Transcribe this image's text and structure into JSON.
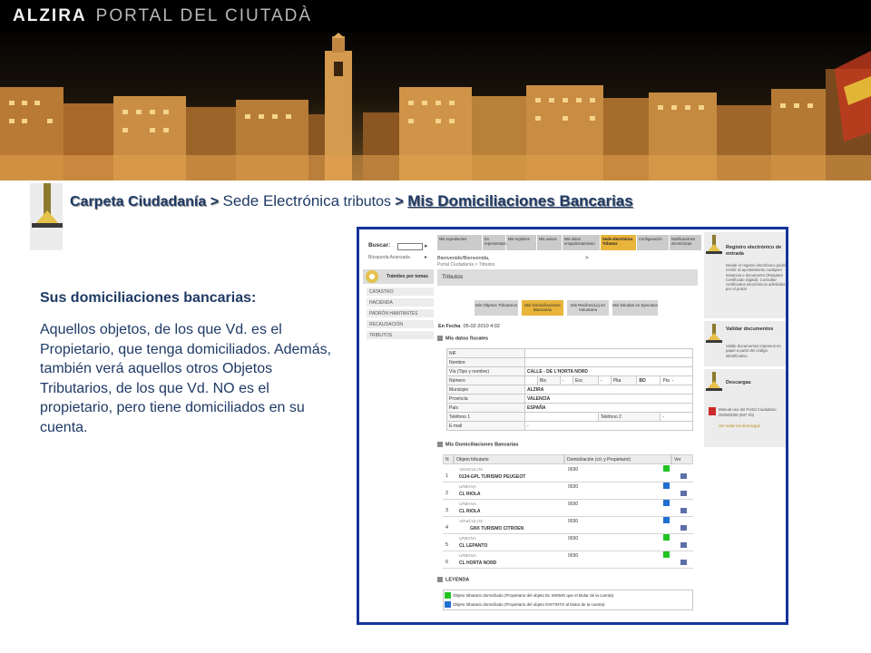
{
  "header": {
    "brand_main": "ALZIRA",
    "brand_sub": "PORTAL DEL CIUTADÀ"
  },
  "breadcrumb": {
    "carpeta": "Carpeta Ciudadanía",
    "sep": ">",
    "sede": "Sede Electrónica",
    "tributos": "tributos",
    "current": "Mis Domiciliaciones Bancarias"
  },
  "description": {
    "title": "Sus domiciliaciones bancarias:",
    "body": "Aquellos objetos, de los que Vd. es el Propietario, que tenga domiciliados. Además, también verá aquellos otros Objetos Tributarios, de los que Vd. NO  es el propietario, pero tiene domiciliados en su cuenta."
  },
  "screenshot": {
    "search_label": "Buscar:",
    "search_value": "",
    "advanced_search": "Búsqueda Avanzada",
    "tramites_label": "Trámites por temas",
    "nav_items": [
      "CATASTRO",
      "HACIENDA",
      "PADRÓN HABITANTES",
      "RECAUDACIÓN",
      "TRIBUTOS"
    ],
    "tabs": [
      "Mis expedientes",
      "En representación",
      "Mis registros",
      "Mis avisos",
      "Mis datos empadronamiento",
      "Sede electrónica Tributos",
      "Configuración",
      "Notificaciones electrónicas"
    ],
    "welcome": "Bienvenido/Bienvenida,",
    "path": "Portal Ciudadanía > Tributos",
    "path_gt": ">",
    "section_title": "Tributos",
    "buttons": [
      "Mis Objetos Tributarios",
      "Mis Domiciliaciones Bancarias",
      "Mis Recibos/Liq en Voluntaria",
      "Mis Deudas en Ejecutiva"
    ],
    "fecha_label": "En Fecha",
    "fecha_value": "05-02-2010 4:02",
    "fiscal_title": "Mis datos fiscales",
    "fiscal": {
      "nif_label": "NIF",
      "nif": "",
      "nombre_label": "Nombre",
      "nombre": "",
      "via_label": "Vía (Tipo y nombre)",
      "via": "CALLE - DE L'HORTA NORD",
      "numero_label": "Número",
      "bis_label": "Bis",
      "bis": "-",
      "esc_label": "Esc",
      "esc": "-",
      "plta_label": "Plta",
      "plta": "BO",
      "pta_label": "Pta",
      "pta": "-",
      "municipio_label": "Municipio",
      "municipio": "ALZIRA",
      "provincia_label": "Provincia",
      "provincia": "VALENCIA",
      "pais_label": "País",
      "pais": "ESPAÑA",
      "telefono1_label": "Teléfono 1",
      "telefono1": "",
      "telefono2_label": "Teléfono 2",
      "telefono2": "-",
      "email_label": "E-mail",
      "email": "-"
    },
    "dom_title": "Mis Domiciliaciones Bancarias",
    "dom_headers": [
      "N",
      "Objeto tributario",
      "Domiciliación (c/c y Propietario)",
      "Ver"
    ],
    "dom_rows": [
      {
        "n": "1",
        "tipo": "VEHICULOS",
        "name": "0134-GPL TURISMO PEUGEOT",
        "cc": "0030",
        "color": "#22c322"
      },
      {
        "n": "2",
        "tipo": "URBANA",
        "name": "CL RIOLA",
        "cc": "0030",
        "color": "#1f6fd0"
      },
      {
        "n": "3",
        "tipo": "URBANA",
        "name": "CL RIOLA",
        "cc": "0030",
        "color": "#1f6fd0"
      },
      {
        "n": "4",
        "tipo": "VEHICULOS",
        "name": "GNX TURISMO CITROEN",
        "cc": "0030",
        "color": "#1f6fd0"
      },
      {
        "n": "5",
        "tipo": "URBANA",
        "name": "CL LEPANTO",
        "cc": "0030",
        "color": "#22c322"
      },
      {
        "n": "6",
        "tipo": "URBANA",
        "name": "CL HORTA NORD",
        "cc": "0030",
        "color": "#22c322"
      }
    ],
    "leyenda_title": "LEYENDA",
    "leyenda": [
      {
        "text": "Objeto tributario domiciliado (Propietario del objeto EL MISMO que el titular de la cuenta)",
        "color": "#22c322"
      },
      {
        "text": "Objeto tributario domiciliado (Propietario del objeto DISTINTO al titular de la cuenta)",
        "color": "#1f6fd0"
      }
    ],
    "right": {
      "registro_title": "Registro electrónico de entrada",
      "registro_text": "Desde el registro electrónico podrá remitir al ayuntamiento cualquier instancia o documento (Requiere Certificado Digital). Consultar certificados electrónicos admitidos por el portal",
      "validar_title": "Validar documentos",
      "validar_text": "Valide documentos impresos en papel a partir del código identificativo",
      "descargas_title": "Descargas",
      "manual_text": "Manual uso del Portal Ciudadano",
      "manual_date": "25/08/2009 (937 Kb)",
      "ver_todas": "Ver todas las descargas"
    }
  },
  "colors": {
    "title_blue": "#1f3a66",
    "frame_blue": "#15349a",
    "accent_gold": "#e8b43a",
    "legend_green": "#22c322",
    "legend_blue": "#1f6fd0"
  }
}
